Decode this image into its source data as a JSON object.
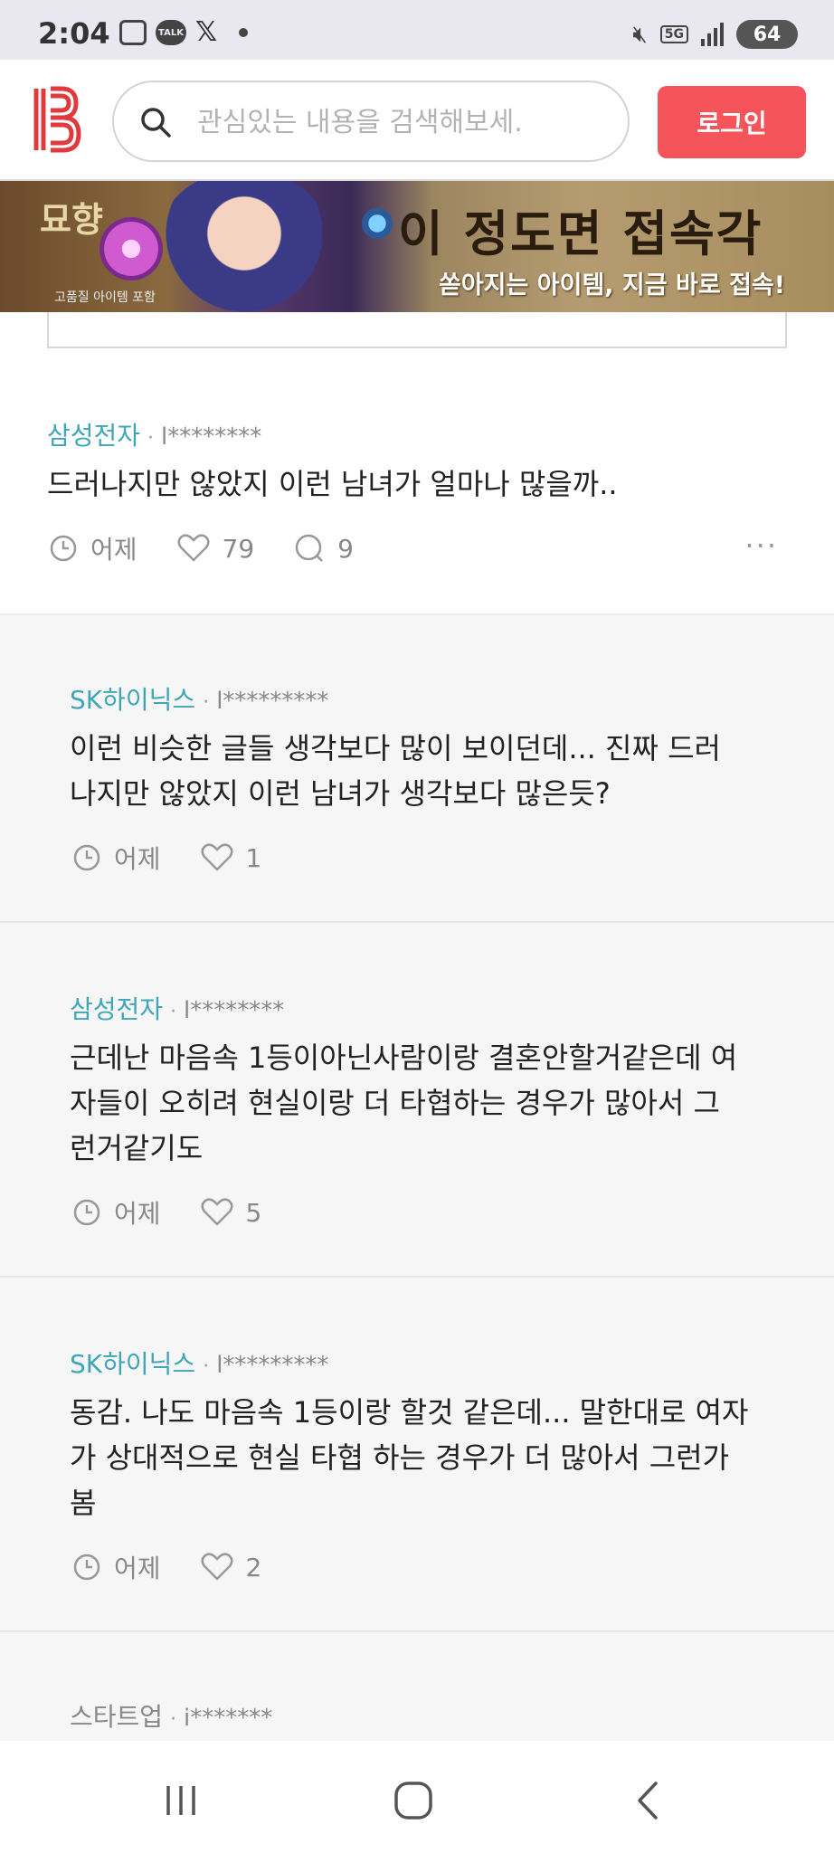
{
  "status_bar": {
    "time": "2:04",
    "notif_talk": "TALK",
    "notif_x": "𝕏",
    "network": "5G",
    "battery": "64"
  },
  "header": {
    "logo": "B",
    "search_placeholder": "관심있는 내용을 검색해보세.",
    "login_label": "로그인"
  },
  "banner": {
    "logo_text": "묘향",
    "sub_text": "고품질 아이템 포함",
    "title": "이 정도면 접속각",
    "tagline": "쏟아지는 아이템, 지금 바로 접속!"
  },
  "comments": [
    {
      "company": "삼성전자",
      "user": "l********",
      "text": [
        "드러나지만 않았지 이런 남녀가 얼마나 많을까.."
      ],
      "time": "어제",
      "likes": "79",
      "replies": "9",
      "more": "···"
    },
    {
      "company": "SK하이닉스",
      "user": "l*********",
      "text": [
        "이런 비슷한 글들 생각보다 많이 보이던데... 진짜 드러",
        "나지만 않았지 이런 남녀가 생각보다 많은듯?"
      ],
      "time": "어제",
      "likes": "1"
    },
    {
      "company": "삼성전자",
      "user": "l********",
      "text": [
        "근데난 마음속 1등이아닌사람이랑 결혼안할거같은데 여",
        "자들이 오히려 현실이랑 더 타협하는 경우가 많아서 그",
        "런거같기도"
      ],
      "time": "어제",
      "likes": "5"
    },
    {
      "company": "SK하이닉스",
      "user": "l*********",
      "text": [
        "동감. 나도 마음속 1등이랑 할것 같은데... 말한대로 여자",
        "가 상대적으로 현실 타협 하는 경우가 더 많아서 그런가",
        "봄"
      ],
      "time": "어제",
      "likes": "2"
    },
    {
      "company": "스타트업",
      "user": "i*******"
    }
  ],
  "colors": {
    "accent": "#f5545a",
    "company": "#3ea6b8",
    "logo": "#e03a3e"
  }
}
